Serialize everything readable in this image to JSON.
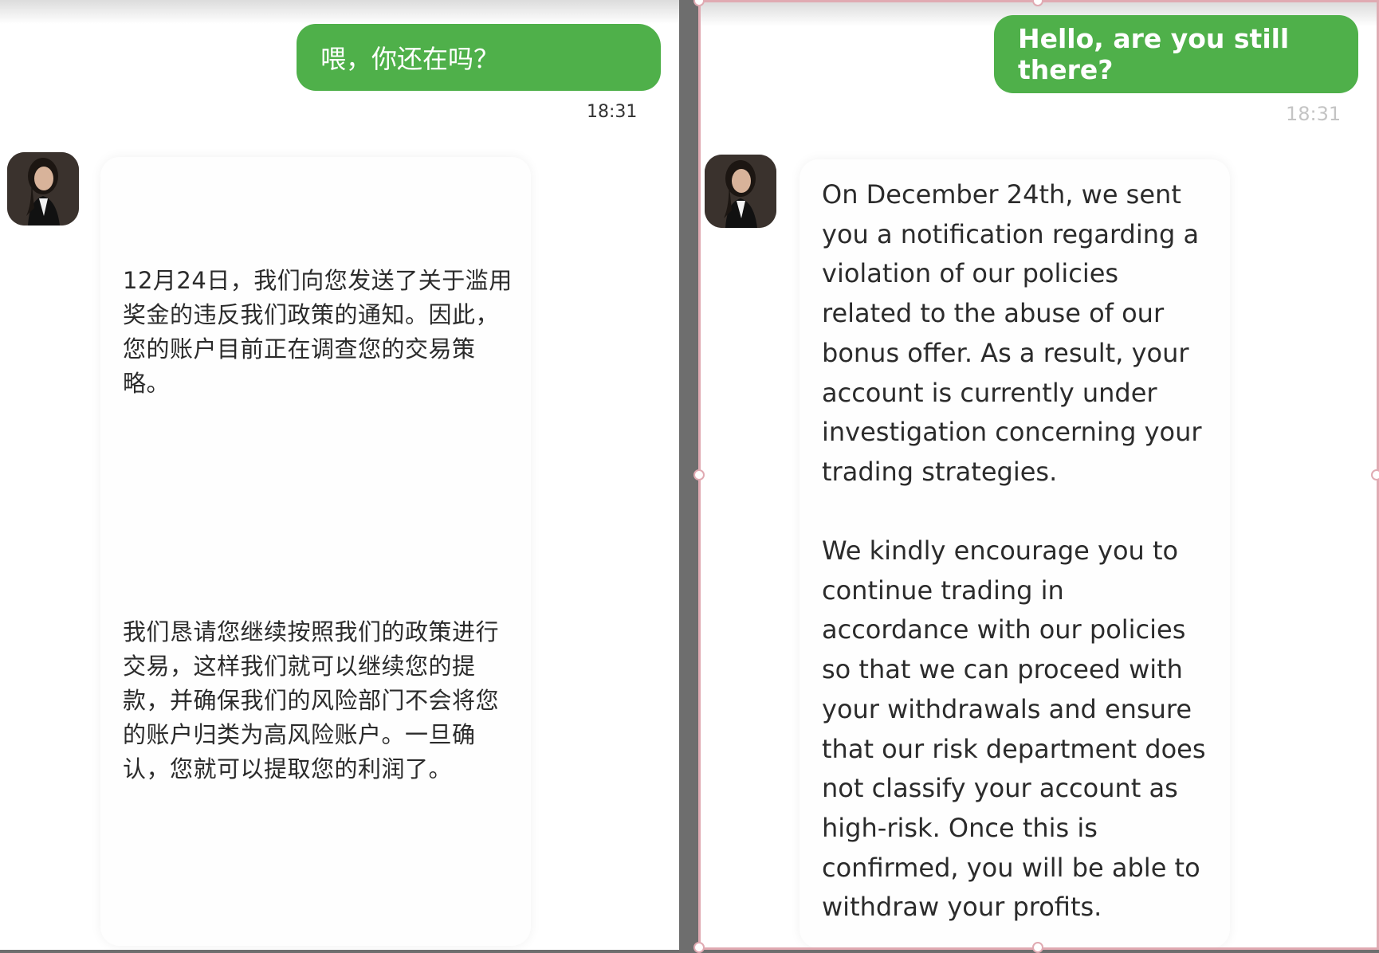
{
  "left_panel": {
    "sent_message": "喂，你还在吗？",
    "sent_time": "18:31",
    "avatar_icon": "agent-avatar-photo",
    "reply_paragraph_1": "12月24日，我们向您发送了关于滥用奖金的违反我们政策的通知。因此，您的账户目前正在调查您的交易策略。",
    "reply_paragraph_2": "我们恳请您继续按照我们的政策进行交易，这样我们就可以继续您的提款，并确保我们的风险部门不会将您的账户归类为高风险账户。一旦确认，您就可以提取您的利润了。"
  },
  "right_panel": {
    "sent_message": "Hello, are you still there?",
    "sent_time": "18:31",
    "avatar_icon": "agent-avatar-photo",
    "reply_paragraph_1": "On December 24th, we sent you a notification regarding a violation of our policies related to the abuse of our bonus offer. As a result, your account is currently under investigation concerning your trading strategies.",
    "reply_paragraph_2": "We kindly encourage you to continue trading in accordance with our policies so that we can proceed with your withdrawals and ensure that our risk department does not classify your account as high-risk. Once this is confirmed, you will be able to withdraw your profits."
  },
  "colors": {
    "outgoing_bubble": "#4fb04a",
    "selection_border": "#e0aab2",
    "divider": "#6e6e6e"
  }
}
